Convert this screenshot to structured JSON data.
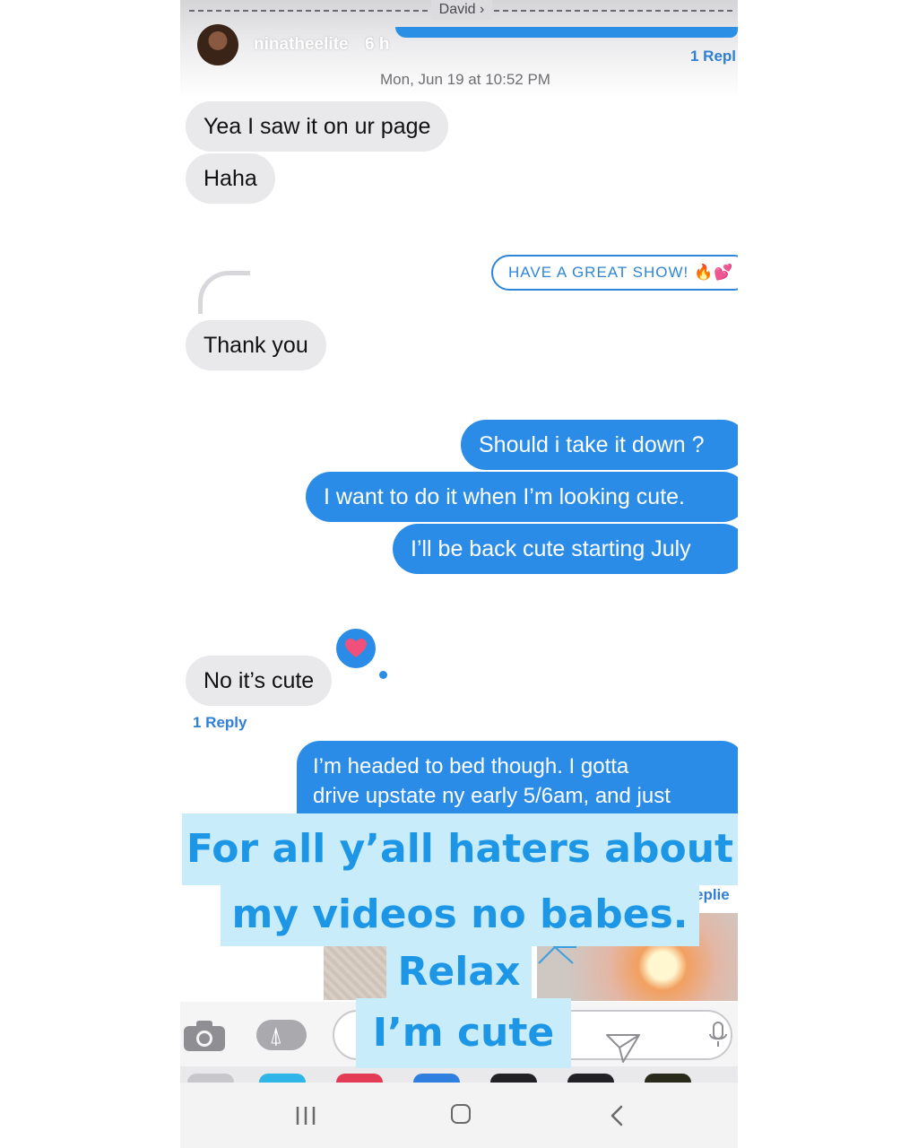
{
  "story_header": {
    "contact_name": "David",
    "contact_chevron": "›",
    "username": "ninatheelite",
    "time_ago": "6 h",
    "reply_count_top": "1 Repl"
  },
  "thread": {
    "timestamp": "Mon, Jun 19 at 10:52 PM",
    "messages": [
      {
        "side": "received",
        "text": "Yea I saw it on ur page"
      },
      {
        "side": "received",
        "text": "Haha"
      },
      {
        "side": "sent-card",
        "text": "HAVE A GREAT SHOW! 🔥💕"
      },
      {
        "side": "received",
        "text": "Thank you"
      },
      {
        "side": "sent",
        "text": "Should i take it down ?"
      },
      {
        "side": "sent",
        "text": "I want to do it when I’m looking cute."
      },
      {
        "side": "sent",
        "text": "I’ll be back cute starting July"
      },
      {
        "side": "received",
        "text": "No it’s cute"
      },
      {
        "side": "sent",
        "lines": [
          "I’m headed to bed though. I gotta",
          "drive upstate ny early 5/6am, and just"
        ]
      }
    ],
    "reply_count_mid": "1 Reply",
    "replies_peek": "eplie",
    "tapback": "heart"
  },
  "caption_overlay": {
    "lines": [
      "For all y’all haters about",
      "my videos no babes.",
      "Relax",
      "I’m cute"
    ],
    "text_color": "#1d96e5",
    "box_color": "#c9ecfb"
  },
  "input_bar": {
    "icons": [
      "camera-icon",
      "app-store-icon",
      "send-icon",
      "microphone-icon"
    ]
  },
  "nav_bar": {
    "icons": [
      "recents-icon",
      "home-icon",
      "back-icon"
    ]
  },
  "colors": {
    "sent_bubble": "#2b8ce8",
    "received_bubble": "#e9e9eb",
    "link_blue": "#2f7fd6"
  }
}
